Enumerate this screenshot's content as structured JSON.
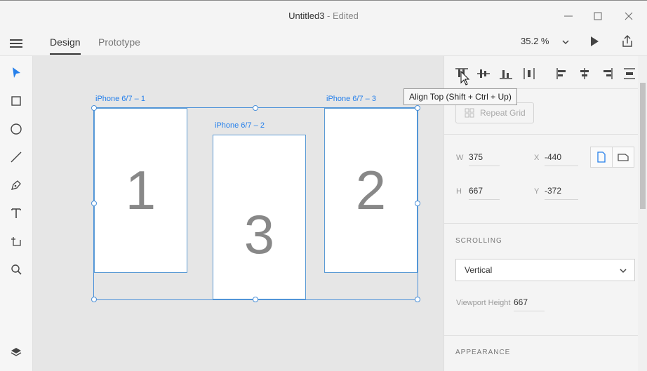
{
  "window": {
    "title": "Untitled3",
    "title_suffix": " - Edited"
  },
  "header": {
    "tabs": [
      {
        "label": "Design",
        "active": true
      },
      {
        "label": "Prototype",
        "active": false
      }
    ],
    "zoom": "35.2 %"
  },
  "tools": [
    "select-icon",
    "rectangle-icon",
    "ellipse-icon",
    "line-icon",
    "pen-icon",
    "text-icon",
    "artboard-icon",
    "zoom-icon",
    "layers-icon"
  ],
  "canvas": {
    "artboards": [
      {
        "label": "iPhone 6/7 – 1",
        "number": "1"
      },
      {
        "label": "iPhone 6/7 – 2",
        "number": "3"
      },
      {
        "label": "iPhone 6/7 – 3",
        "number": "2"
      }
    ]
  },
  "tooltip": "Align Top (Shift + Ctrl + Up)",
  "panel": {
    "repeat_grid": "Repeat Grid",
    "w_label": "W",
    "w_value": "375",
    "x_label": "X",
    "x_value": "-440",
    "h_label": "H",
    "h_value": "667",
    "y_label": "Y",
    "y_value": "-372",
    "scrolling_title": "SCROLLING",
    "scrolling_value": "Vertical",
    "viewport_label": "Viewport Height",
    "viewport_value": "667",
    "appearance_title": "APPEARANCE"
  },
  "colors": {
    "accent": "#2680eb",
    "selection": "#4a90d9"
  }
}
